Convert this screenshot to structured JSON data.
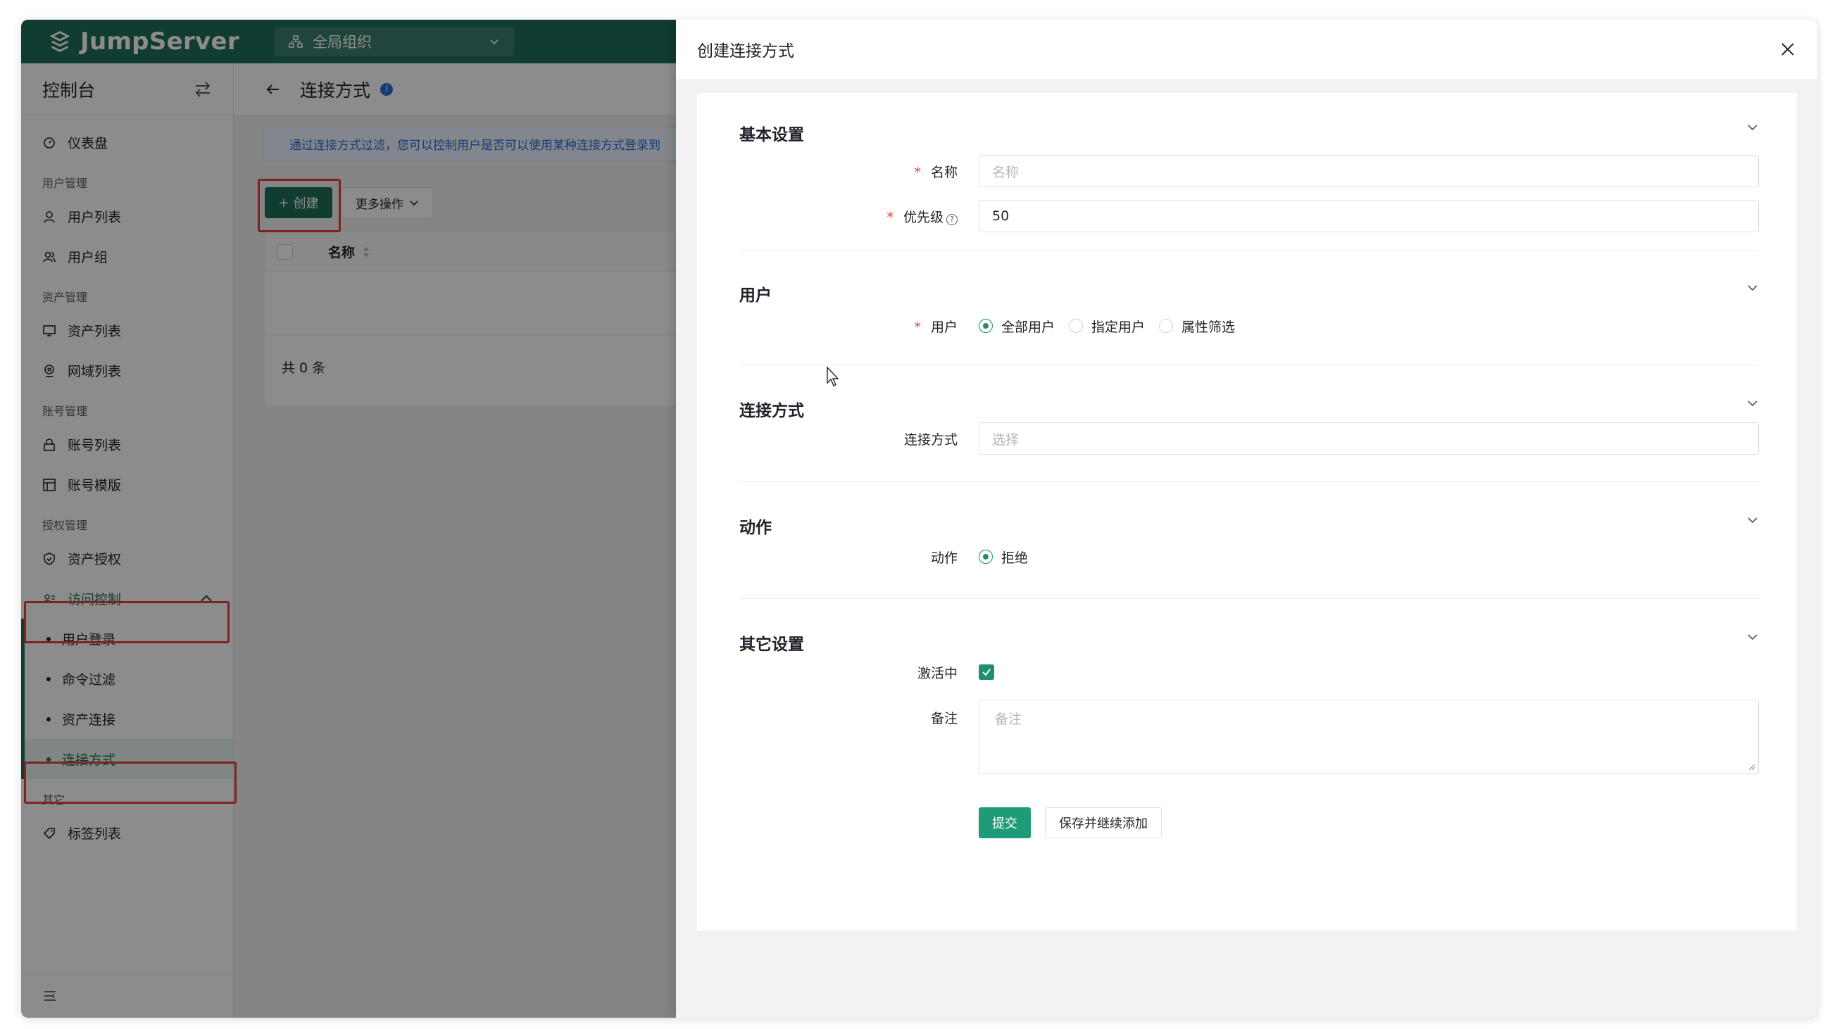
{
  "app": {
    "name": "JumpServer"
  },
  "org": {
    "label": "全局组织"
  },
  "sidebar": {
    "title": "控制台",
    "items": [
      {
        "label": "仪表盘"
      },
      {
        "group": "用户管理"
      },
      {
        "label": "用户列表"
      },
      {
        "label": "用户组"
      },
      {
        "group": "资产管理"
      },
      {
        "label": "资产列表"
      },
      {
        "label": "网域列表"
      },
      {
        "group": "账号管理"
      },
      {
        "label": "账号列表"
      },
      {
        "label": "账号模版"
      },
      {
        "group": "授权管理"
      },
      {
        "label": "资产授权"
      },
      {
        "label": "访问控制"
      },
      {
        "label": "用户登录"
      },
      {
        "label": "命令过滤"
      },
      {
        "label": "资产连接"
      },
      {
        "label": "连接方式"
      },
      {
        "group": "其它"
      },
      {
        "label": "标签列表"
      }
    ]
  },
  "page": {
    "title": "连接方式",
    "notice": "通过连接方式过滤，您可以控制用户是否可以使用某种连接方式登录到",
    "create_label": "创建",
    "more_label": "更多操作",
    "col_name": "名称",
    "total": "共 0 条"
  },
  "drawer": {
    "title": "创建连接方式",
    "sections": {
      "basic": "基本设置",
      "user": "用户",
      "connect": "连接方式",
      "action": "动作",
      "other": "其它设置"
    },
    "fields": {
      "name_label": "名称",
      "name_placeholder": "名称",
      "priority_label": "优先级",
      "priority_value": "50",
      "user_label": "用户",
      "user_options": [
        "全部用户",
        "指定用户",
        "属性筛选"
      ],
      "user_selected": "全部用户",
      "connect_label": "连接方式",
      "connect_placeholder": "选择",
      "action_label": "动作",
      "action_option": "拒绝",
      "active_label": "激活中",
      "active_checked": true,
      "comment_label": "备注",
      "comment_placeholder": "备注"
    },
    "buttons": {
      "submit": "提交",
      "save_continue": "保存并继续添加"
    }
  },
  "colors": {
    "brand": "#1e6e59",
    "accent": "#1e9b77",
    "highlight": "#e53e3e"
  }
}
